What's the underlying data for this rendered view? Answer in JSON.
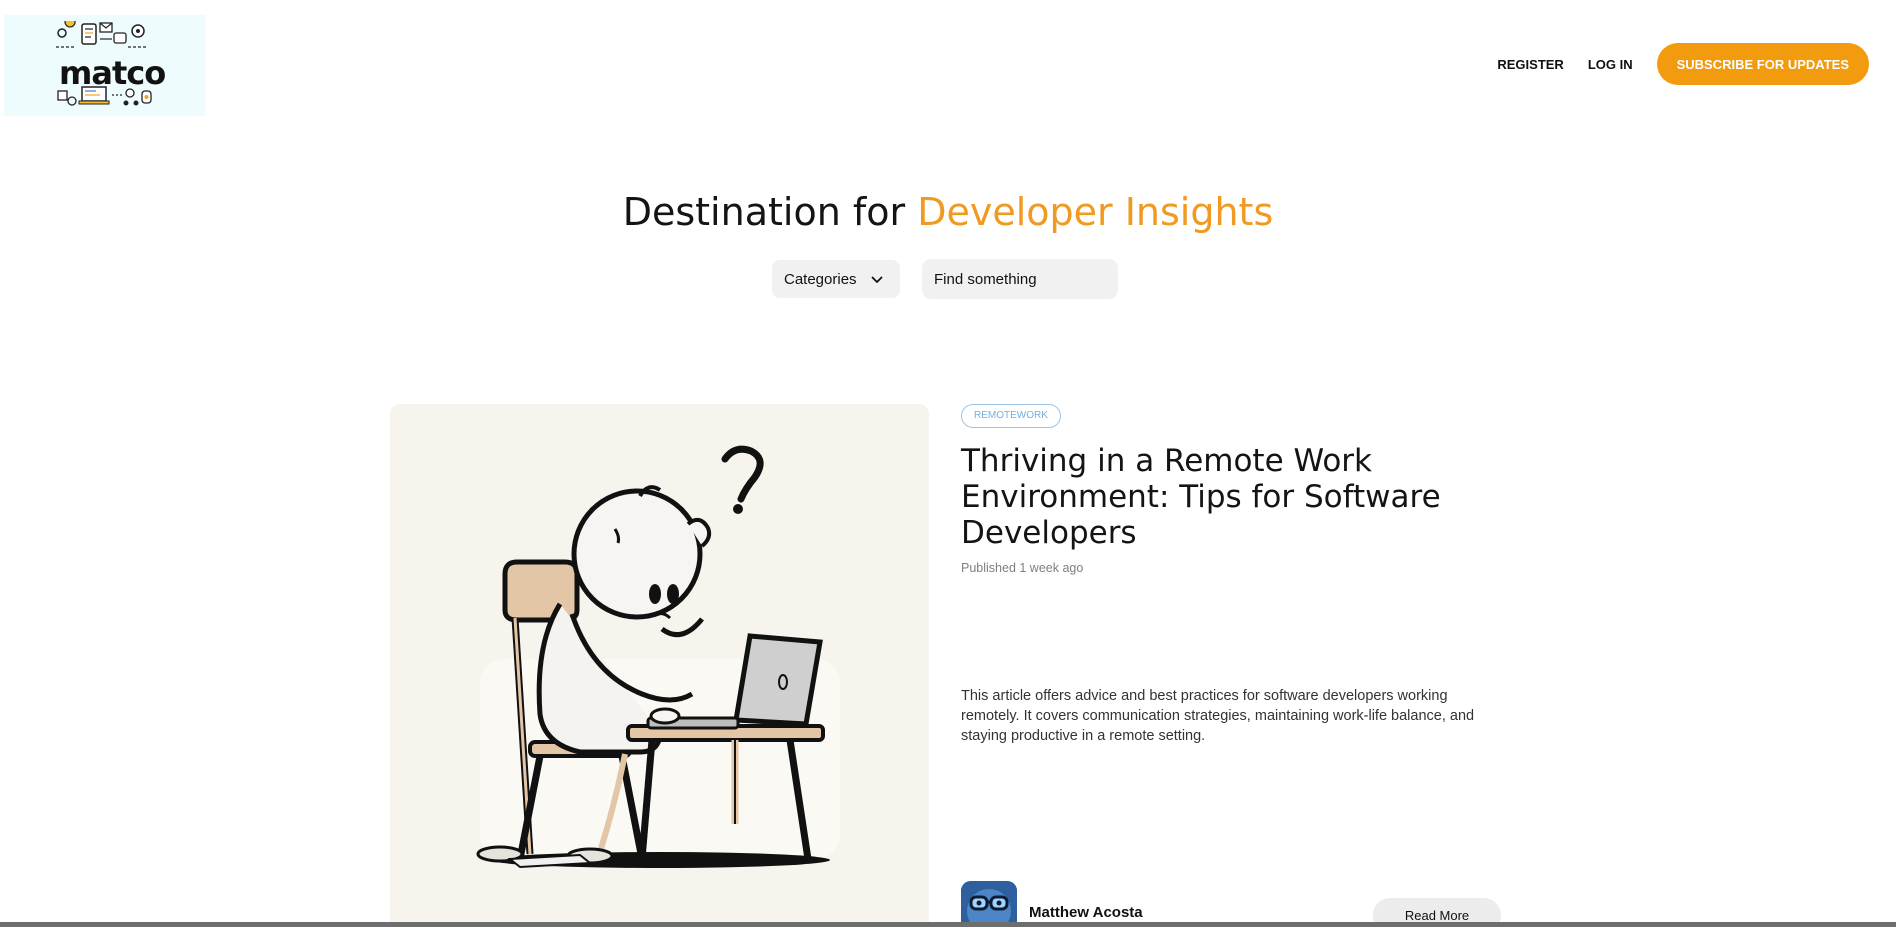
{
  "header": {
    "logo_text": "matco",
    "nav": {
      "register_label": "REGISTER",
      "login_label": "LOG IN",
      "subscribe_label": "SUBSCRIBE FOR UPDATES"
    }
  },
  "hero": {
    "title_prefix": "Destination for ",
    "title_accent": "Developer Insights"
  },
  "filters": {
    "categories_label": "Categories",
    "search_placeholder": "Find something"
  },
  "article": {
    "tag": "REMOTEWORK",
    "title": "Thriving in a Remote Work Environment: Tips for Software Developers",
    "published": "Published 1 week ago",
    "excerpt": "This article offers advice and best practices for software developers working remotely. It covers communication strategies, maintaining work-life balance, and staying productive in a remote setting.",
    "author": "Matthew Acosta",
    "read_more_label": "Read More"
  },
  "colors": {
    "accent": "#f29b0f",
    "accent_text": "#f19a22",
    "tag_border": "#9ec4e6",
    "tag_text": "#76aee0",
    "logo_bg": "#effcfd"
  },
  "icons": [
    "chevron-down-icon",
    "lightbulb-icon",
    "envelope-icon",
    "laptop-icon",
    "gear-icon"
  ]
}
